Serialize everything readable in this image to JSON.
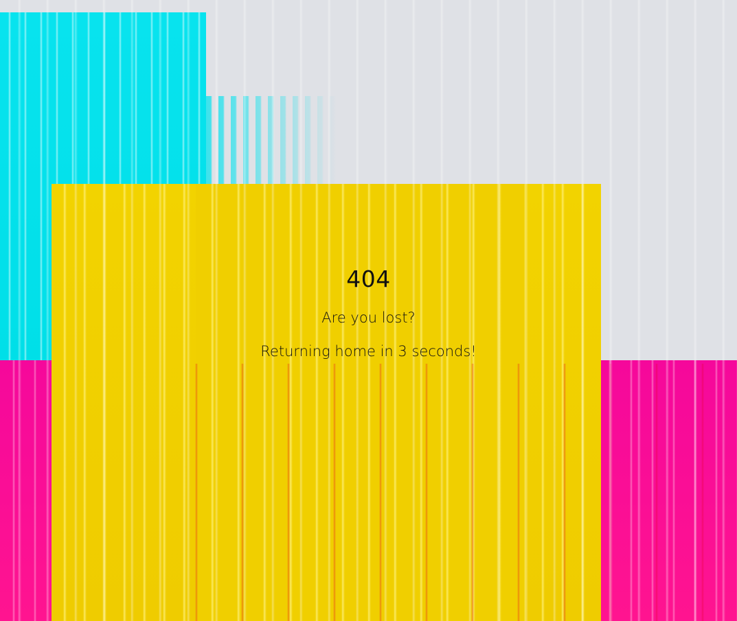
{
  "page": {
    "error_code": "404",
    "question": "Are you lost?",
    "redirect_message": "Returning home in 3 seconds!"
  },
  "colors": {
    "background": "#dfe1e6",
    "cyan": "#08e3ee",
    "yellow": "#f0cf00",
    "magenta": "#f5089b",
    "text": "#111111"
  }
}
